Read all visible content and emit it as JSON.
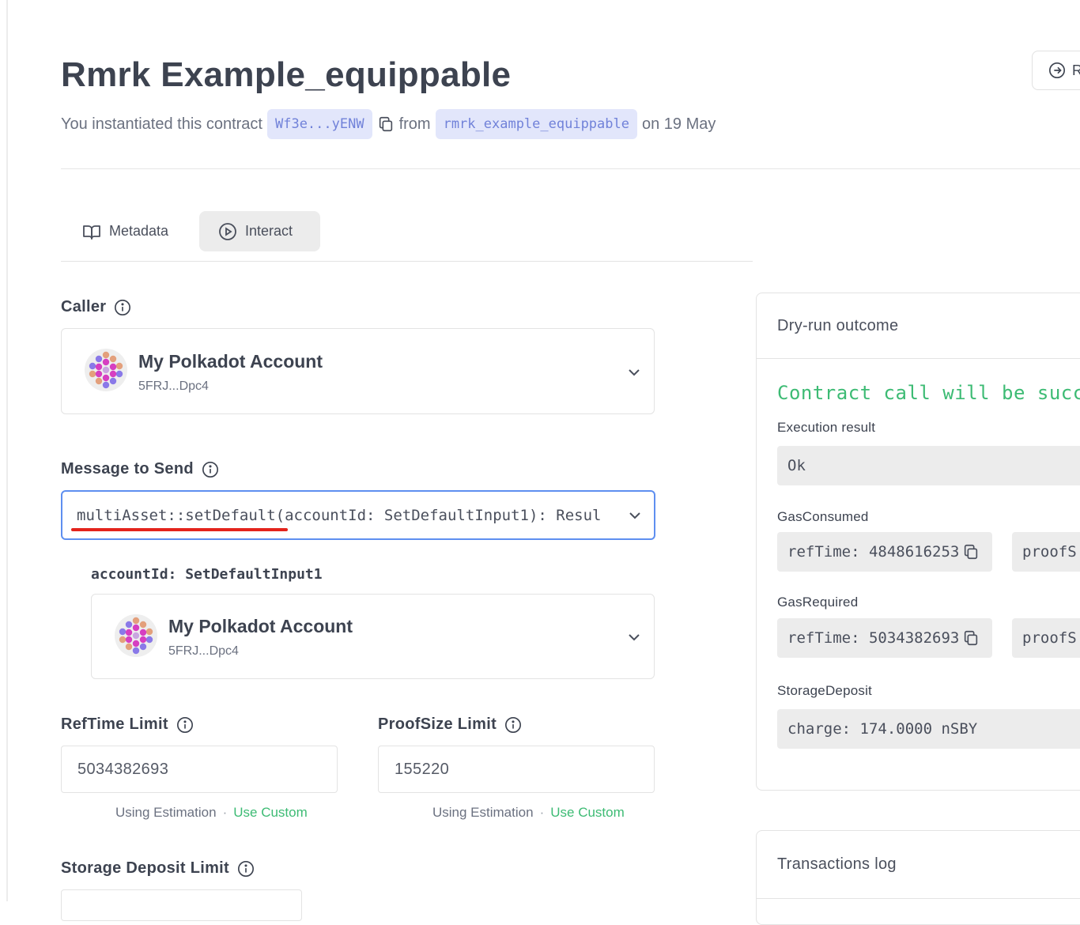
{
  "header": {
    "title": "Rmrk Example_equippable",
    "subtitle_prefix": "You instantiated this contract",
    "address_chip": "Wf3e...yENW",
    "from_text": "from",
    "code_chip": "rmrk_example_equippable",
    "date_text": "on 19 May",
    "top_right_button_label": "R"
  },
  "tabs": [
    {
      "label": "Metadata",
      "icon": "book-icon",
      "active": false
    },
    {
      "label": "Interact",
      "icon": "play-circle-icon",
      "active": true
    }
  ],
  "caller": {
    "label": "Caller",
    "account_name": "My Polkadot Account",
    "account_address": "5FRJ...Dpc4"
  },
  "message": {
    "label": "Message to Send",
    "selected": "multiAsset::setDefault(accountId: SetDefaultInput1): Resul",
    "arg_label": "accountId: SetDefaultInput1",
    "arg_account_name": "My Polkadot Account",
    "arg_account_address": "5FRJ...Dpc4"
  },
  "limits": {
    "reftime_label": "RefTime Limit",
    "reftime_value": "5034382693",
    "proofsize_label": "ProofSize Limit",
    "proofsize_value": "155220",
    "using_estimation": "Using Estimation",
    "separator": "·",
    "use_custom": "Use Custom",
    "storage_label": "Storage Deposit Limit"
  },
  "dry_run": {
    "title": "Dry-run outcome",
    "status": "Contract call will be success",
    "execution_label": "Execution result",
    "execution_value": "Ok",
    "gas_consumed_label": "GasConsumed",
    "gas_consumed_reftime": "refTime: 4848616253",
    "gas_consumed_proof": "proofS",
    "gas_required_label": "GasRequired",
    "gas_required_reftime": "refTime: 5034382693",
    "gas_required_proof": "proofS",
    "storage_label": "StorageDeposit",
    "storage_value": "charge: 174.0000 nSBY"
  },
  "tx_log": {
    "title": "Transactions log"
  },
  "colors": {
    "accent_blue": "#5e8ff0",
    "chip_bg": "#e2e6fb",
    "chip_text": "#7182d9",
    "success_green": "#3dbb74",
    "annotation_red": "#e3231c"
  }
}
